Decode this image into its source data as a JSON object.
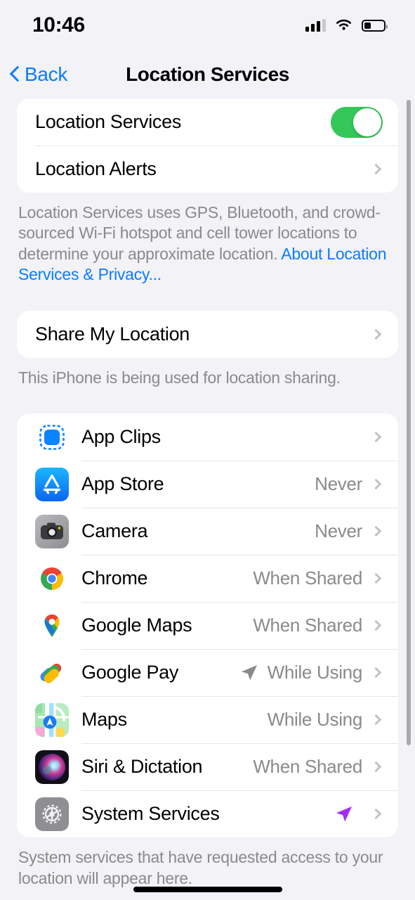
{
  "status_bar": {
    "time": "10:46",
    "signal_icon": "cellular-bars-icon",
    "wifi_icon": "wifi-icon",
    "battery_icon": "battery-low-icon",
    "signal_bars_filled": 3,
    "signal_bars_total": 4,
    "battery_percent": 28
  },
  "nav": {
    "back_label": "Back",
    "back_icon": "chevron-left-icon",
    "title": "Location Services"
  },
  "section_main": {
    "rows": [
      {
        "label": "Location Services",
        "control": "toggle",
        "toggle_on": true
      },
      {
        "label": "Location Alerts",
        "control": "chevron"
      }
    ],
    "footer": {
      "text": "Location Services uses GPS, Bluetooth, and crowd-sourced Wi-Fi hotspot and cell tower locations to determine your approximate location. ",
      "link": "About Location Services & Privacy..."
    }
  },
  "section_share": {
    "rows": [
      {
        "label": "Share My Location",
        "control": "chevron"
      }
    ],
    "footer": {
      "text": "This iPhone is being used for location sharing."
    }
  },
  "section_apps": {
    "rows": [
      {
        "icon": "app-clips-icon",
        "label": "App Clips",
        "value": "",
        "arrow": "none"
      },
      {
        "icon": "app-store-icon",
        "label": "App Store",
        "value": "Never",
        "arrow": "none"
      },
      {
        "icon": "camera-icon",
        "label": "Camera",
        "value": "Never",
        "arrow": "none"
      },
      {
        "icon": "chrome-icon",
        "label": "Chrome",
        "value": "When Shared",
        "arrow": "none"
      },
      {
        "icon": "google-maps-icon",
        "label": "Google Maps",
        "value": "When Shared",
        "arrow": "none"
      },
      {
        "icon": "google-pay-icon",
        "label": "Google Pay",
        "value": "While Using",
        "arrow": "gray"
      },
      {
        "icon": "apple-maps-icon",
        "label": "Maps",
        "value": "While Using",
        "arrow": "none"
      },
      {
        "icon": "siri-icon",
        "label": "Siri & Dictation",
        "value": "When Shared",
        "arrow": "none"
      },
      {
        "icon": "system-services-icon",
        "label": "System Services",
        "value": "",
        "arrow": "purple"
      }
    ],
    "footer": {
      "text": "System services that have requested access to your location will appear here."
    }
  },
  "colors": {
    "page_background": "#f2f2f7",
    "card_background": "#ffffff",
    "accent_blue": "#0a7cff",
    "toggle_green": "#34c759",
    "secondary_text": "#8a8a8e",
    "arrow_purple": "#a22df0",
    "arrow_gray": "#8a8a8e"
  }
}
